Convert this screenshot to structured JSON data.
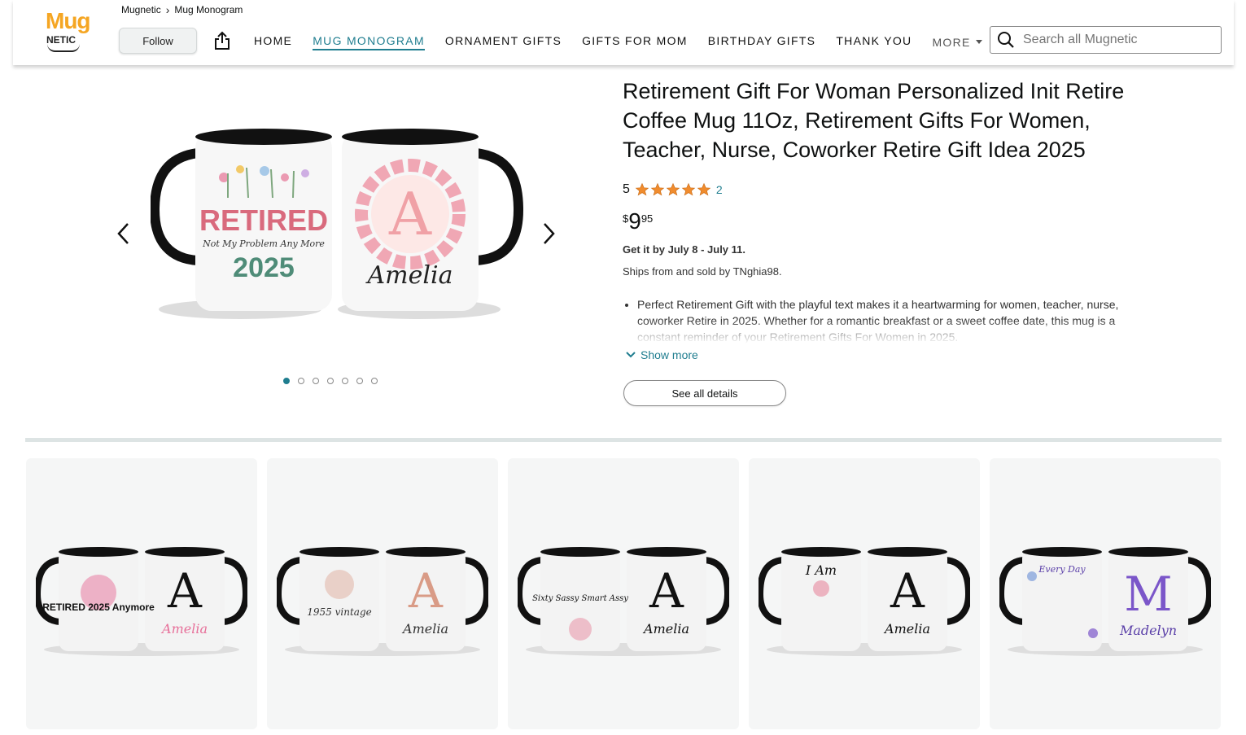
{
  "brand": {
    "logo_top": "Mug",
    "logo_bottom": "NETIC"
  },
  "breadcrumb": {
    "store": "Mugnetic",
    "section": "Mug Monogram"
  },
  "header": {
    "follow_label": "Follow"
  },
  "nav": {
    "items": [
      {
        "label": "HOME"
      },
      {
        "label": "MUG MONOGRAM",
        "active": true
      },
      {
        "label": "ORNAMENT GIFTS"
      },
      {
        "label": "GIFTS FOR MOM"
      },
      {
        "label": "BIRTHDAY GIFTS"
      },
      {
        "label": "THANK YOU"
      }
    ],
    "more_label": "MORE"
  },
  "search": {
    "placeholder": "Search all Mugnetic"
  },
  "product": {
    "title": "Retirement Gift For Woman Personalized Init Retire Coffee Mug 11Oz, Retirement Gifts For Women, Teacher, Nurse, Coworker Retire Gift Idea 2025",
    "rating": "5",
    "rating_count": "2",
    "price": {
      "currency": "$",
      "whole": "9",
      "fraction": "95"
    },
    "delivery": "Get it by July 8 - July 11.",
    "ships": "Ships from and sold by TNghia98.",
    "bullet": "Perfect Retirement Gift with the playful text makes it a heartwarming for women, teacher, nurse, coworker Retire in 2025. Whether for a romantic breakfast or a sweet coffee date, this mug is a constant reminder of your Retirement Gifts For Women in 2025.",
    "show_more": "Show more",
    "see_all": "See all details",
    "image": {
      "left_text_1": "RETIRED",
      "left_text_2": "Not My Problem Any More",
      "left_text_3": "2025",
      "right_letter": "A",
      "right_name": "Amelia"
    },
    "gallery_dots": 7,
    "gallery_active": 0
  },
  "related": [
    {
      "left_text": "RETIRED 2025 Anymore",
      "letter": "A",
      "name": "Amelia",
      "accent": "#e7709a"
    },
    {
      "left_text": "1955 vintage",
      "letter": "A",
      "name": "Amelia",
      "accent": "#d99b86"
    },
    {
      "left_text": "Sixty Sassy Smart Assy",
      "letter": "A",
      "name": "Amelia",
      "accent": "#e8899f"
    },
    {
      "left_text": "I Am",
      "letter": "A",
      "name": "Amelia",
      "accent": "#e8899f"
    },
    {
      "left_text": "Every Day",
      "letter": "M",
      "name": "Madelyn",
      "accent": "#7b56c9"
    }
  ],
  "colors": {
    "accent": "#1f7d8f",
    "star": "#f08c2e",
    "logo": "#f5a623"
  }
}
